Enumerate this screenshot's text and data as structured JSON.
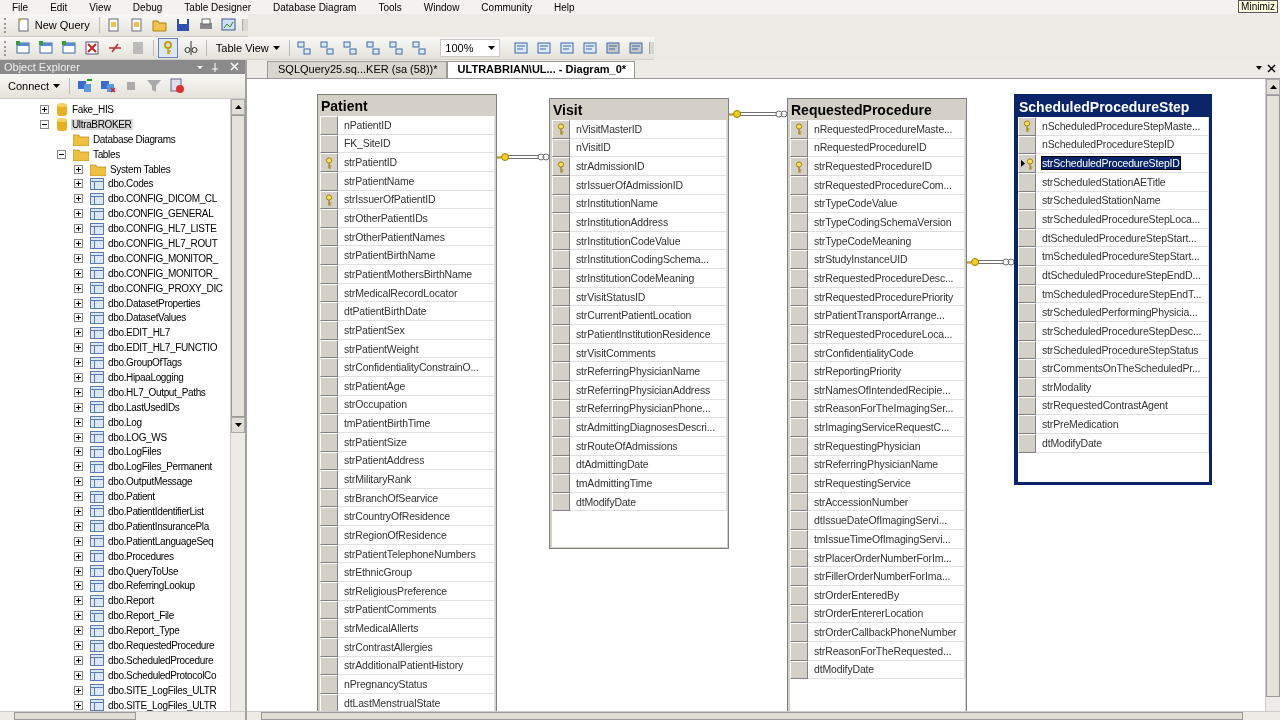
{
  "menu": [
    "File",
    "Edit",
    "View",
    "Debug",
    "Table Designer",
    "Database Diagram",
    "Tools",
    "Window",
    "Community",
    "Help"
  ],
  "toolbar": {
    "new_query": "New Query",
    "table_view": "Table View",
    "zoom": "100%"
  },
  "object_explorer": {
    "title": "Object Explorer",
    "connect": "Connect",
    "tree": [
      {
        "label": "Fake_HIS",
        "kind": "database",
        "expanded": false,
        "selected": false
      },
      {
        "label": "UltraBROKER",
        "kind": "database",
        "expanded": true,
        "selected": true,
        "children": [
          {
            "label": "Database Diagrams",
            "kind": "folder",
            "selected": false
          },
          {
            "label": "Tables",
            "kind": "folder",
            "expanded": true,
            "selected": false,
            "children": [
              {
                "label": "System Tables",
                "kind": "folder",
                "expanded": false,
                "selected": false
              },
              {
                "label": "dbo.Codes",
                "kind": "table",
                "expanded": false,
                "selected": false
              },
              {
                "label": "dbo.CONFIG_DICOM_CL",
                "kind": "table",
                "expanded": false,
                "selected": false
              },
              {
                "label": "dbo.CONFIG_GENERAL",
                "kind": "table",
                "expanded": false,
                "selected": false
              },
              {
                "label": "dbo.CONFIG_HL7_LISTE",
                "kind": "table",
                "expanded": false,
                "selected": false
              },
              {
                "label": "dbo.CONFIG_HL7_ROUT",
                "kind": "table",
                "expanded": false,
                "selected": false
              },
              {
                "label": "dbo.CONFIG_MONITOR_",
                "kind": "table",
                "expanded": false,
                "selected": false
              },
              {
                "label": "dbo.CONFIG_MONITOR_",
                "kind": "table",
                "expanded": false,
                "selected": false
              },
              {
                "label": "dbo.CONFIG_PROXY_DIC",
                "kind": "table",
                "expanded": false,
                "selected": false
              },
              {
                "label": "dbo.DatasetProperties",
                "kind": "table",
                "expanded": false,
                "selected": false
              },
              {
                "label": "dbo.DatasetValues",
                "kind": "table",
                "expanded": false,
                "selected": false
              },
              {
                "label": "dbo.EDIT_HL7",
                "kind": "table",
                "expanded": false,
                "selected": false
              },
              {
                "label": "dbo.EDIT_HL7_FUNCTIO",
                "kind": "table",
                "expanded": false,
                "selected": false
              },
              {
                "label": "dbo.GroupOfTags",
                "kind": "table",
                "expanded": false,
                "selected": false
              },
              {
                "label": "dbo.HipaaLogging",
                "kind": "table",
                "expanded": false,
                "selected": false
              },
              {
                "label": "dbo.HL7_Output_Paths",
                "kind": "table",
                "expanded": false,
                "selected": false
              },
              {
                "label": "dbo.LastUsedIDs",
                "kind": "table",
                "expanded": false,
                "selected": false
              },
              {
                "label": "dbo.Log",
                "kind": "table",
                "expanded": false,
                "selected": false
              },
              {
                "label": "dbo.LOG_WS",
                "kind": "table",
                "expanded": false,
                "selected": false
              },
              {
                "label": "dbo.LogFiles",
                "kind": "table",
                "expanded": false,
                "selected": false
              },
              {
                "label": "dbo.LogFiles_Permanent",
                "kind": "table",
                "expanded": false,
                "selected": false
              },
              {
                "label": "dbo.OutputMessage",
                "kind": "table",
                "expanded": false,
                "selected": false
              },
              {
                "label": "dbo.Patient",
                "kind": "table",
                "expanded": false,
                "selected": false
              },
              {
                "label": "dbo.PatientIdentifierList",
                "kind": "table",
                "expanded": false,
                "selected": false
              },
              {
                "label": "dbo.PatientInsurancePla",
                "kind": "table",
                "expanded": false,
                "selected": false
              },
              {
                "label": "dbo.PatientLanguageSeq",
                "kind": "table",
                "expanded": false,
                "selected": false
              },
              {
                "label": "dbo.Procedures",
                "kind": "table",
                "expanded": false,
                "selected": false
              },
              {
                "label": "dbo.QueryToUse",
                "kind": "table",
                "expanded": false,
                "selected": false
              },
              {
                "label": "dbo.ReferringLookup",
                "kind": "table",
                "expanded": false,
                "selected": false
              },
              {
                "label": "dbo.Report",
                "kind": "table",
                "expanded": false,
                "selected": false
              },
              {
                "label": "dbo.Report_File",
                "kind": "table",
                "expanded": false,
                "selected": false
              },
              {
                "label": "dbo.Report_Type",
                "kind": "table",
                "expanded": false,
                "selected": false
              },
              {
                "label": "dbo.RequestedProcedure",
                "kind": "table",
                "expanded": false,
                "selected": false
              },
              {
                "label": "dbo.ScheduledProcedure",
                "kind": "table",
                "expanded": false,
                "selected": false
              },
              {
                "label": "dbo.ScheduledProtocolCo",
                "kind": "table",
                "expanded": false,
                "selected": false
              },
              {
                "label": "dbo.SITE_LogFiles_ULTR",
                "kind": "table",
                "expanded": false,
                "selected": false
              },
              {
                "label": "dbo.SITE_LogFiles_ULTR",
                "kind": "table",
                "expanded": false,
                "selected": false
              }
            ]
          }
        ]
      }
    ]
  },
  "tabs": [
    {
      "label": "SQLQuery25.sq...KER (sa (58))*",
      "selected": false
    },
    {
      "label": "ULTRABRIAN\\UL... - Diagram_0*",
      "selected": true
    }
  ],
  "tables": [
    {
      "name": "Patient",
      "selected": false,
      "columns": [
        {
          "name": "nPatientID",
          "key": false,
          "selected": false
        },
        {
          "name": "FK_SiteID",
          "key": false,
          "selected": false
        },
        {
          "name": "strPatientID",
          "key": true,
          "selected": false
        },
        {
          "name": "strPatientName",
          "key": false,
          "selected": false
        },
        {
          "name": "strIssuerOfPatientID",
          "key": true,
          "selected": false
        },
        {
          "name": "strOtherPatientIDs",
          "key": false,
          "selected": false
        },
        {
          "name": "strOtherPatientNames",
          "key": false,
          "selected": false
        },
        {
          "name": "strPatientBirthName",
          "key": false,
          "selected": false
        },
        {
          "name": "strPatientMothersBirthName",
          "key": false,
          "selected": false
        },
        {
          "name": "strMedicalRecordLocator",
          "key": false,
          "selected": false
        },
        {
          "name": "dtPatientBirthDate",
          "key": false,
          "selected": false
        },
        {
          "name": "strPatientSex",
          "key": false,
          "selected": false
        },
        {
          "name": "strPatientWeight",
          "key": false,
          "selected": false
        },
        {
          "name": "strConfidentialityConstrainO...",
          "key": false,
          "selected": false
        },
        {
          "name": "strPatientAge",
          "key": false,
          "selected": false
        },
        {
          "name": "strOccupation",
          "key": false,
          "selected": false
        },
        {
          "name": "tmPatientBirthTime",
          "key": false,
          "selected": false
        },
        {
          "name": "strPatientSize",
          "key": false,
          "selected": false
        },
        {
          "name": "strPatientAddress",
          "key": false,
          "selected": false
        },
        {
          "name": "strMilitaryRank",
          "key": false,
          "selected": false
        },
        {
          "name": "strBranchOfSearvice",
          "key": false,
          "selected": false
        },
        {
          "name": "strCountryOfResidence",
          "key": false,
          "selected": false
        },
        {
          "name": "strRegionOfResidence",
          "key": false,
          "selected": false
        },
        {
          "name": "strPatientTelephoneNumbers",
          "key": false,
          "selected": false
        },
        {
          "name": "strEthnicGroup",
          "key": false,
          "selected": false
        },
        {
          "name": "strReligiousPreference",
          "key": false,
          "selected": false
        },
        {
          "name": "strPatientComments",
          "key": false,
          "selected": false
        },
        {
          "name": "strMedicalAllerts",
          "key": false,
          "selected": false
        },
        {
          "name": "strContrastAllergies",
          "key": false,
          "selected": false
        },
        {
          "name": "strAdditionalPatientHistory",
          "key": false,
          "selected": false
        },
        {
          "name": "nPregnancyStatus",
          "key": false,
          "selected": false
        },
        {
          "name": "dtLastMenstrualState",
          "key": false,
          "selected": false
        }
      ]
    },
    {
      "name": "Visit",
      "selected": false,
      "columns": [
        {
          "name": "nVisitMasterID",
          "key": true,
          "selected": false
        },
        {
          "name": "nVisitID",
          "key": false,
          "selected": false
        },
        {
          "name": "strAdmissionID",
          "key": true,
          "selected": false
        },
        {
          "name": "strIssuerOfAdmissionID",
          "key": false,
          "selected": false
        },
        {
          "name": "strInstitutionName",
          "key": false,
          "selected": false
        },
        {
          "name": "strInstitutionAddress",
          "key": false,
          "selected": false
        },
        {
          "name": "strInstitutionCodeValue",
          "key": false,
          "selected": false
        },
        {
          "name": "strInstitutionCodingSchema...",
          "key": false,
          "selected": false
        },
        {
          "name": "strInstitutionCodeMeaning",
          "key": false,
          "selected": false
        },
        {
          "name": "strVisitStatusID",
          "key": false,
          "selected": false
        },
        {
          "name": "strCurrentPatientLocation",
          "key": false,
          "selected": false
        },
        {
          "name": "strPatientInstitutionResidence",
          "key": false,
          "selected": false
        },
        {
          "name": "strVisitComments",
          "key": false,
          "selected": false
        },
        {
          "name": "strReferringPhysicianName",
          "key": false,
          "selected": false
        },
        {
          "name": "strReferringPhysicianAddress",
          "key": false,
          "selected": false
        },
        {
          "name": "strReferringPhysicianPhone...",
          "key": false,
          "selected": false
        },
        {
          "name": "strAdmittingDiagnosesDescri...",
          "key": false,
          "selected": false
        },
        {
          "name": "strRouteOfAdmissions",
          "key": false,
          "selected": false
        },
        {
          "name": "dtAdmittingDate",
          "key": false,
          "selected": false
        },
        {
          "name": "tmAdmittingTime",
          "key": false,
          "selected": false
        },
        {
          "name": "dtModifyDate",
          "key": false,
          "selected": false
        }
      ]
    },
    {
      "name": "RequestedProcedure",
      "selected": false,
      "columns": [
        {
          "name": "nRequestedProcedureMaste...",
          "key": true,
          "selected": false
        },
        {
          "name": "nRequestedProcedureID",
          "key": false,
          "selected": false
        },
        {
          "name": "strRequestedProcedureID",
          "key": true,
          "selected": false
        },
        {
          "name": "strRequestedProcedureCom...",
          "key": false,
          "selected": false
        },
        {
          "name": "strTypeCodeValue",
          "key": false,
          "selected": false
        },
        {
          "name": "strTypeCodingSchemaVersion",
          "key": false,
          "selected": false
        },
        {
          "name": "strTypeCodeMeaning",
          "key": false,
          "selected": false
        },
        {
          "name": "strStudyInstanceUID",
          "key": false,
          "selected": false
        },
        {
          "name": "strRequestedProcedureDesc...",
          "key": false,
          "selected": false
        },
        {
          "name": "strRequestedProcedurePriority",
          "key": false,
          "selected": false
        },
        {
          "name": "strPatientTransportArrange...",
          "key": false,
          "selected": false
        },
        {
          "name": "strRequestedProcedureLoca...",
          "key": false,
          "selected": false
        },
        {
          "name": "strConfidentialityCode",
          "key": false,
          "selected": false
        },
        {
          "name": "strReportingPriority",
          "key": false,
          "selected": false
        },
        {
          "name": "strNamesOfIntendedRecipie...",
          "key": false,
          "selected": false
        },
        {
          "name": "strReasonForTheImagingSer...",
          "key": false,
          "selected": false
        },
        {
          "name": "strImagingServiceRequestC...",
          "key": false,
          "selected": false
        },
        {
          "name": "strRequestingPhysician",
          "key": false,
          "selected": false
        },
        {
          "name": "strReferringPhysicianName",
          "key": false,
          "selected": false
        },
        {
          "name": "strRequestingService",
          "key": false,
          "selected": false
        },
        {
          "name": "strAccessionNumber",
          "key": false,
          "selected": false
        },
        {
          "name": "dtIssueDateOfImagingServi...",
          "key": false,
          "selected": false
        },
        {
          "name": "tmIssueTimeOfImagingServi...",
          "key": false,
          "selected": false
        },
        {
          "name": "strPlacerOrderNumberForIm...",
          "key": false,
          "selected": false
        },
        {
          "name": "strFillerOrderNumberForIma...",
          "key": false,
          "selected": false
        },
        {
          "name": "strOrderEnteredBy",
          "key": false,
          "selected": false
        },
        {
          "name": "strOrderEntererLocation",
          "key": false,
          "selected": false
        },
        {
          "name": "strOrderCallbackPhoneNumber",
          "key": false,
          "selected": false
        },
        {
          "name": "strReasonForTheRequested...",
          "key": false,
          "selected": false
        },
        {
          "name": "dtModifyDate",
          "key": false,
          "selected": false
        }
      ]
    },
    {
      "name": "ScheduledProcedureStep",
      "selected": true,
      "columns": [
        {
          "name": "nScheduledProcedureStepMaste...",
          "key": true,
          "selected": false
        },
        {
          "name": "nScheduledProcedureStepID",
          "key": false,
          "selected": false
        },
        {
          "name": "strScheduledProcedureStepID",
          "key": true,
          "selected": true
        },
        {
          "name": "strScheduledStationAETitle",
          "key": false,
          "selected": false
        },
        {
          "name": "strScheduledStationName",
          "key": false,
          "selected": false
        },
        {
          "name": "strScheduledProcedureStepLoca...",
          "key": false,
          "selected": false
        },
        {
          "name": "dtScheduledProcedureStepStart...",
          "key": false,
          "selected": false
        },
        {
          "name": "tmScheduledProcedureStepStart...",
          "key": false,
          "selected": false
        },
        {
          "name": "dtScheduledProcedureStepEndD...",
          "key": false,
          "selected": false
        },
        {
          "name": "tmScheduledProcedureStepEndT...",
          "key": false,
          "selected": false
        },
        {
          "name": "strScheduledPerformingPhysicia...",
          "key": false,
          "selected": false
        },
        {
          "name": "strScheduledProcedureStepDesc...",
          "key": false,
          "selected": false
        },
        {
          "name": "strScheduledProcedureStepStatus",
          "key": false,
          "selected": false
        },
        {
          "name": "strCommentsOnTheScheduledPr...",
          "key": false,
          "selected": false
        },
        {
          "name": "strModality",
          "key": false,
          "selected": false
        },
        {
          "name": "strRequestedContrastAgent",
          "key": false,
          "selected": false
        },
        {
          "name": "strPreMedication",
          "key": false,
          "selected": false
        },
        {
          "name": "dtModifyDate",
          "key": false,
          "selected": false
        }
      ]
    }
  ],
  "tooltip": "Minimiz"
}
